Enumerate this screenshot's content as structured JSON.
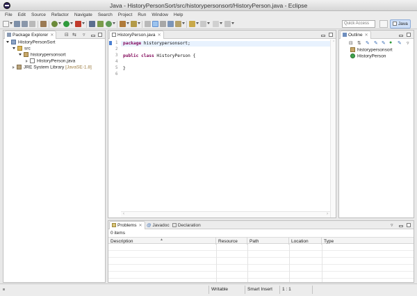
{
  "window": {
    "title": "Java - HistoryPersonSort/src/historypersonsort/HistoryPerson.java - Eclipse"
  },
  "menu": [
    "File",
    "Edit",
    "Source",
    "Refactor",
    "Navigate",
    "Search",
    "Project",
    "Run",
    "Window",
    "Help"
  ],
  "toolbar": {
    "quick_access_placeholder": "Quick Access",
    "perspective_label": "Java"
  },
  "package_explorer": {
    "tab_label": "Package Explorer",
    "tree": {
      "project": "HistoryPersonSort",
      "src": "src",
      "package": "historypersonsort",
      "file": "HistoryPerson.java",
      "jre": "JRE System Library",
      "jre_version": "[JavaSE-1.8]"
    }
  },
  "editor": {
    "tab_label": "HistoryPerson.java",
    "line_numbers": [
      "1",
      "2",
      "3",
      "4",
      "5",
      "6"
    ],
    "lines": [
      {
        "kw": "package",
        "rest": " historypersonsort;"
      },
      {
        "kw": "",
        "rest": ""
      },
      {
        "kw": "public class",
        "rest": " HistoryPerson {"
      },
      {
        "kw": "",
        "rest": ""
      },
      {
        "kw": "",
        "rest": "}"
      },
      {
        "kw": "",
        "rest": ""
      }
    ]
  },
  "outline": {
    "tab_label": "Outline",
    "items": [
      "historypersonsort",
      "HistoryPerson"
    ]
  },
  "problems": {
    "tabs": [
      "Problems",
      "Javadoc",
      "Declaration"
    ],
    "count_label": "0 items",
    "columns": [
      "Description",
      "Resource",
      "Path",
      "Location",
      "Type"
    ]
  },
  "statusbar": {
    "mode": "Writable",
    "insert": "Smart Insert",
    "position": "1 : 1"
  },
  "colors": {
    "keyword": "#7f0055",
    "selection": "#cfe0f7",
    "line_highlight": "#e8f2fe"
  }
}
